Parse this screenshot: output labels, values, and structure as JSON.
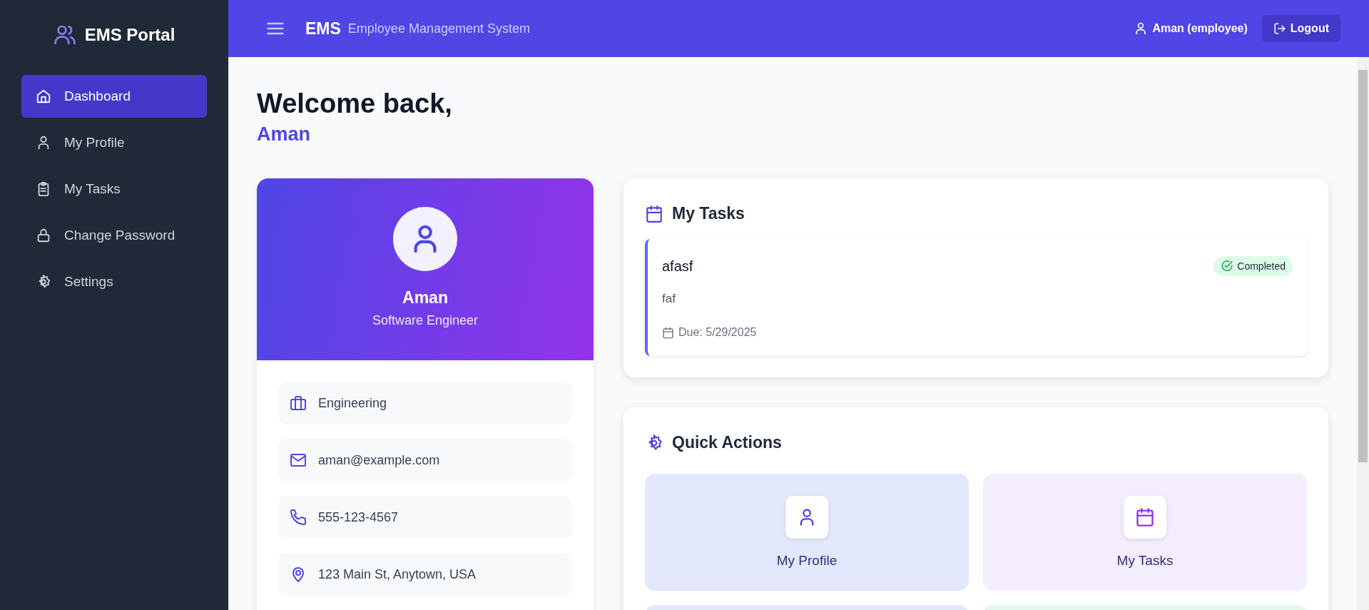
{
  "sidebar": {
    "brand": "EMS Portal",
    "items": [
      {
        "label": "Dashboard",
        "kind": "home",
        "selected": true
      },
      {
        "label": "My Profile",
        "kind": "user",
        "selected": false
      },
      {
        "label": "My Tasks",
        "kind": "clipboard",
        "selected": false
      },
      {
        "label": "Change Password",
        "kind": "lock",
        "selected": false
      },
      {
        "label": "Settings",
        "kind": "gear",
        "selected": false
      }
    ]
  },
  "header": {
    "logo": "EMS",
    "subtitle": "Employee Management System",
    "user": "Aman (employee)",
    "logout": "Logout"
  },
  "welcome": {
    "title": "Welcome back,",
    "name": "Aman"
  },
  "profile": {
    "name": "Aman",
    "role": "Software Engineer",
    "details": [
      {
        "kind": "briefcase",
        "text": "Engineering"
      },
      {
        "kind": "mail",
        "text": "aman@example.com"
      },
      {
        "kind": "phone",
        "text": "555-123-4567"
      },
      {
        "kind": "pin",
        "text": "123 Main St, Anytown, USA"
      }
    ]
  },
  "tasks": {
    "title": "My Tasks",
    "items": [
      {
        "title": "afasf",
        "description": "faf",
        "due": "Due: 5/29/2025",
        "status": "Completed",
        "kind": "completed"
      }
    ]
  },
  "quick_actions": {
    "title": "Quick Actions",
    "items": [
      {
        "label": "My Profile",
        "kind": "user",
        "color": "#e3e8fc"
      },
      {
        "label": "My Tasks",
        "kind": "calendar",
        "color": "#f3edfd"
      },
      {
        "color": "#e3e8fc"
      },
      {
        "color": "#e4f9ec"
      }
    ]
  }
}
